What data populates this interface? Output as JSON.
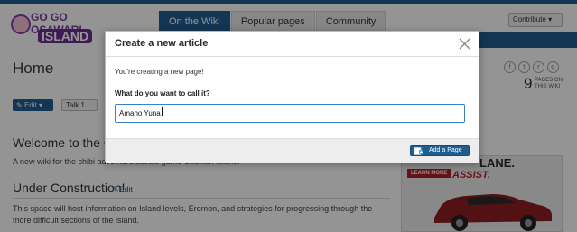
{
  "wiki": {
    "logo_line1": "GO GO OSAWARI",
    "logo_line2": "ISLAND",
    "nav_tabs": [
      "On the Wiki",
      "Popular pages",
      "Community"
    ],
    "contribute_label": "Contribute",
    "page_title": "Home",
    "pages_count": "9",
    "pages_label": "PAGES ON THIS WIKI",
    "edit_label": "Edit",
    "talk_label": "Talk",
    "talk_count": "1",
    "welcome_heading": "Welcome to the Os",
    "description": "A new wiki for the chibi adventure/casual game Osawari Island!",
    "under_heading": "Under Construction!",
    "under_edit_label": "Edit",
    "body_text": "This space will host information on Island levels, Eromon, and strategies for progressing through the more difficult sections of the island.",
    "ad_headline": "LANE.",
    "ad_tagline": "ASSIST.",
    "ad_cta": "LEARN MORE"
  },
  "modal": {
    "title": "Create a new article",
    "intro": "You're creating a new page!",
    "question": "What do you want to call it?",
    "input_value": "Amano Yuna",
    "add_button_label": "Add a Page"
  },
  "icons": {
    "close": "close-icon",
    "add_page": "add-page-icon",
    "edit": "pencil-icon",
    "social": [
      "facebook-icon",
      "twitter-icon",
      "reddit-icon",
      "google-plus-icon"
    ]
  },
  "colors": {
    "accent": "#1f5d8f",
    "input_border": "#3b7fc4",
    "ad_red": "#b3202a"
  }
}
